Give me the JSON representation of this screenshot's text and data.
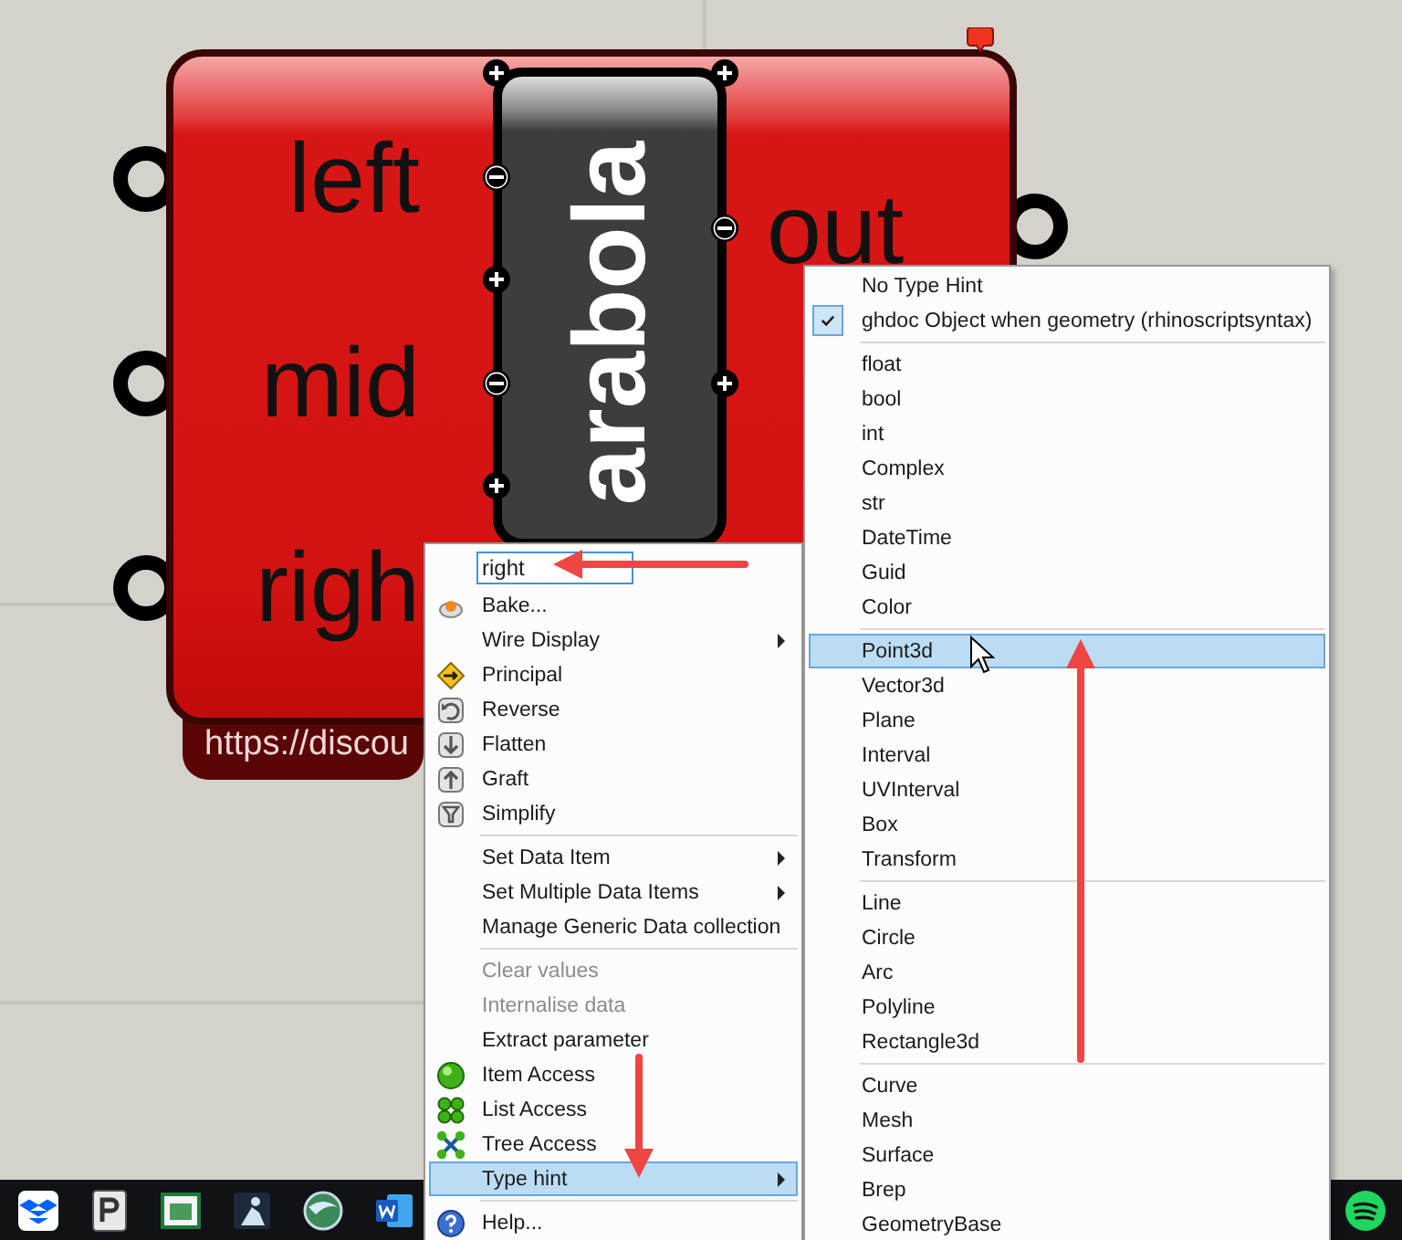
{
  "component": {
    "inputs": [
      {
        "label": "left"
      },
      {
        "label": "mid"
      },
      {
        "label": "righ"
      }
    ],
    "title": "arabola",
    "outputs": [
      {
        "label": "out"
      }
    ],
    "tooltip": "https://discou"
  },
  "context_menu": {
    "name_field": {
      "value": "right"
    },
    "items": [
      {
        "kind": "item",
        "label": "Bake...",
        "submenu": false,
        "disabled": false,
        "selected": false
      },
      {
        "kind": "item",
        "label": "Wire Display",
        "submenu": true,
        "disabled": false,
        "selected": false
      },
      {
        "kind": "item",
        "label": "Principal",
        "submenu": false,
        "disabled": false,
        "selected": false
      },
      {
        "kind": "item",
        "label": "Reverse",
        "submenu": false,
        "disabled": false,
        "selected": false
      },
      {
        "kind": "item",
        "label": "Flatten",
        "submenu": false,
        "disabled": false,
        "selected": false
      },
      {
        "kind": "item",
        "label": "Graft",
        "submenu": false,
        "disabled": false,
        "selected": false
      },
      {
        "kind": "item",
        "label": "Simplify",
        "submenu": false,
        "disabled": false,
        "selected": false
      },
      {
        "kind": "separator"
      },
      {
        "kind": "item",
        "label": "Set Data Item",
        "submenu": true,
        "disabled": false,
        "selected": false
      },
      {
        "kind": "item",
        "label": "Set Multiple Data Items",
        "submenu": true,
        "disabled": false,
        "selected": false
      },
      {
        "kind": "item",
        "label": "Manage Generic Data collection",
        "submenu": false,
        "disabled": false,
        "selected": false
      },
      {
        "kind": "separator"
      },
      {
        "kind": "item",
        "label": "Clear values",
        "submenu": false,
        "disabled": true,
        "selected": false
      },
      {
        "kind": "item",
        "label": "Internalise data",
        "submenu": false,
        "disabled": true,
        "selected": false
      },
      {
        "kind": "item",
        "label": "Extract parameter",
        "submenu": false,
        "disabled": false,
        "selected": false
      },
      {
        "kind": "item",
        "label": "Item Access",
        "submenu": false,
        "disabled": false,
        "selected": false
      },
      {
        "kind": "item",
        "label": "List Access",
        "submenu": false,
        "disabled": false,
        "selected": false
      },
      {
        "kind": "item",
        "label": "Tree Access",
        "submenu": false,
        "disabled": false,
        "selected": false
      },
      {
        "kind": "item",
        "label": "Type hint",
        "submenu": true,
        "disabled": false,
        "selected": true
      },
      {
        "kind": "separator"
      },
      {
        "kind": "item",
        "label": "Help...",
        "submenu": false,
        "disabled": false,
        "selected": false
      }
    ]
  },
  "type_hint_menu": {
    "items": [
      {
        "kind": "item",
        "label": "No Type Hint",
        "checked": false,
        "selected": false
      },
      {
        "kind": "item",
        "label": "ghdoc Object when geometry (rhinoscriptsyntax)",
        "checked": true,
        "selected": false
      },
      {
        "kind": "separator"
      },
      {
        "kind": "item",
        "label": "float",
        "checked": false,
        "selected": false
      },
      {
        "kind": "item",
        "label": "bool",
        "checked": false,
        "selected": false
      },
      {
        "kind": "item",
        "label": "int",
        "checked": false,
        "selected": false
      },
      {
        "kind": "item",
        "label": "Complex",
        "checked": false,
        "selected": false
      },
      {
        "kind": "item",
        "label": "str",
        "checked": false,
        "selected": false
      },
      {
        "kind": "item",
        "label": "DateTime",
        "checked": false,
        "selected": false
      },
      {
        "kind": "item",
        "label": "Guid",
        "checked": false,
        "selected": false
      },
      {
        "kind": "item",
        "label": "Color",
        "checked": false,
        "selected": false
      },
      {
        "kind": "separator"
      },
      {
        "kind": "item",
        "label": "Point3d",
        "checked": false,
        "selected": true
      },
      {
        "kind": "item",
        "label": "Vector3d",
        "checked": false,
        "selected": false
      },
      {
        "kind": "item",
        "label": "Plane",
        "checked": false,
        "selected": false
      },
      {
        "kind": "item",
        "label": "Interval",
        "checked": false,
        "selected": false
      },
      {
        "kind": "item",
        "label": "UVInterval",
        "checked": false,
        "selected": false
      },
      {
        "kind": "item",
        "label": "Box",
        "checked": false,
        "selected": false
      },
      {
        "kind": "item",
        "label": "Transform",
        "checked": false,
        "selected": false
      },
      {
        "kind": "separator"
      },
      {
        "kind": "item",
        "label": "Line",
        "checked": false,
        "selected": false
      },
      {
        "kind": "item",
        "label": "Circle",
        "checked": false,
        "selected": false
      },
      {
        "kind": "item",
        "label": "Arc",
        "checked": false,
        "selected": false
      },
      {
        "kind": "item",
        "label": "Polyline",
        "checked": false,
        "selected": false
      },
      {
        "kind": "item",
        "label": "Rectangle3d",
        "checked": false,
        "selected": false
      },
      {
        "kind": "separator"
      },
      {
        "kind": "item",
        "label": "Curve",
        "checked": false,
        "selected": false
      },
      {
        "kind": "item",
        "label": "Mesh",
        "checked": false,
        "selected": false
      },
      {
        "kind": "item",
        "label": "Surface",
        "checked": false,
        "selected": false
      },
      {
        "kind": "item",
        "label": "Brep",
        "checked": false,
        "selected": false
      },
      {
        "kind": "item",
        "label": "GeometryBase",
        "checked": false,
        "selected": false
      }
    ]
  }
}
